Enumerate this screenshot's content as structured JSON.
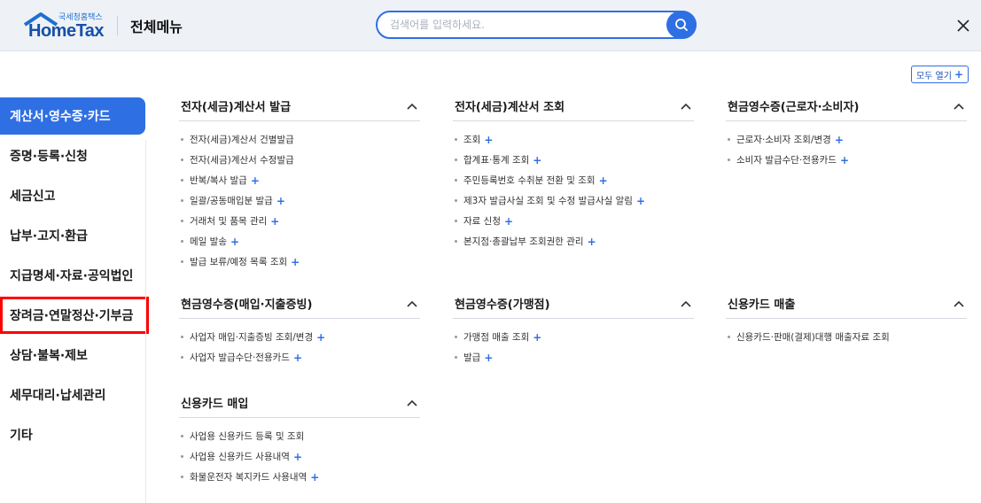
{
  "header": {
    "logo_small": "국세청홈택스",
    "logo_big": "HomeTax",
    "title": "전체메뉴",
    "search_placeholder": "검색어를 입력하세요."
  },
  "open_all": "모두 열기",
  "sidebar": {
    "items": [
      {
        "label": "계산서·영수증·카드"
      },
      {
        "label": "증명·등록·신청"
      },
      {
        "label": "세금신고"
      },
      {
        "label": "납부·고지·환급"
      },
      {
        "label": "지급명세·자료·공익법인"
      },
      {
        "label": "장려금·연말정산·기부금"
      },
      {
        "label": "상담·불복·제보"
      },
      {
        "label": "세무대리·납세관리"
      },
      {
        "label": "기타"
      }
    ]
  },
  "sections": [
    {
      "title": "전자(세금)계산서 발급",
      "items": [
        {
          "label": "전자(세금)계산서 건별발급",
          "plus": false
        },
        {
          "label": "전자(세금)계산서 수정발급",
          "plus": false
        },
        {
          "label": "반복/복사 발급",
          "plus": true
        },
        {
          "label": "일괄/공동매입분 발급",
          "plus": true
        },
        {
          "label": "거래처 및 품목 관리",
          "plus": true
        },
        {
          "label": "메일 발송",
          "plus": true
        },
        {
          "label": "발급 보류/예정 목록 조회",
          "plus": true
        }
      ]
    },
    {
      "title": "전자(세금)계산서 조회",
      "items": [
        {
          "label": "조회",
          "plus": true
        },
        {
          "label": "합계표·통계 조회",
          "plus": true
        },
        {
          "label": "주민등록번호 수취분 전환 및 조회",
          "plus": true
        },
        {
          "label": "제3자 발급사실 조회 및 수정 발급사실 알림",
          "plus": true
        },
        {
          "label": "자료 신청",
          "plus": true
        },
        {
          "label": "본지점·총괄납부 조회권한 관리",
          "plus": true
        }
      ]
    },
    {
      "title": "현금영수증(근로자·소비자)",
      "items": [
        {
          "label": "근로자·소비자 조회/변경",
          "plus": true
        },
        {
          "label": "소비자 발급수단·전용카드",
          "plus": true
        }
      ]
    },
    {
      "title": "현금영수증(매입·지출증빙)",
      "items": [
        {
          "label": "사업자 매입·지출증빙 조회/변경",
          "plus": true
        },
        {
          "label": "사업자 발급수단·전용카드",
          "plus": true
        }
      ]
    },
    {
      "title": "현금영수증(가맹점)",
      "items": [
        {
          "label": "가맹점 매출 조회",
          "plus": true
        },
        {
          "label": "발급",
          "plus": true
        }
      ]
    },
    {
      "title": "신용카드 매출",
      "items": [
        {
          "label": "신용카드·판매(결제)대행 매출자료 조회",
          "plus": false
        }
      ]
    },
    {
      "title": "신용카드 매입",
      "items": [
        {
          "label": "사업용 신용카드 등록 및 조회",
          "plus": false
        },
        {
          "label": "사업용 신용카드 사용내역",
          "plus": true
        },
        {
          "label": "화물운전자 복지카드 사용내역",
          "plus": true
        }
      ]
    }
  ]
}
